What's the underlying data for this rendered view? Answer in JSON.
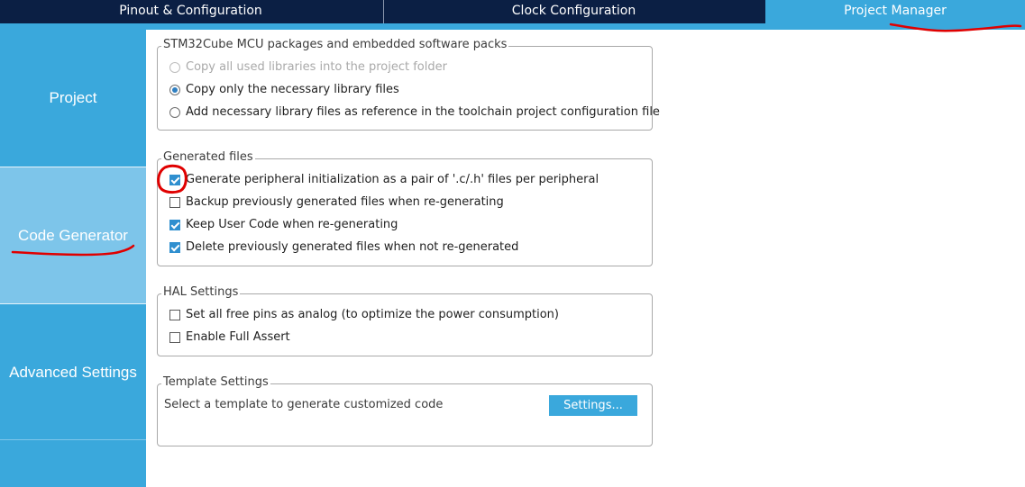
{
  "tabs": [
    {
      "label": "Pinout & Configuration"
    },
    {
      "label": "Clock Configuration"
    },
    {
      "label": "Project Manager"
    }
  ],
  "sidebar": {
    "items": [
      {
        "label": "Project"
      },
      {
        "label": "Code Generator"
      },
      {
        "label": "Advanced Settings"
      }
    ]
  },
  "packages": {
    "title": "STM32Cube MCU packages and embedded software packs",
    "options": [
      {
        "label": "Copy all used libraries into the project folder",
        "selected": false,
        "enabled": false
      },
      {
        "label": "Copy only the necessary library files",
        "selected": true,
        "enabled": true
      },
      {
        "label": "Add necessary library files as reference in the toolchain project configuration file",
        "selected": false,
        "enabled": true
      }
    ]
  },
  "generated": {
    "title": "Generated files",
    "options": [
      {
        "label": "Generate peripheral initialization as a pair of '.c/.h' files per peripheral",
        "checked": true
      },
      {
        "label": "Backup previously generated files when re-generating",
        "checked": false
      },
      {
        "label": "Keep User Code when re-generating",
        "checked": true
      },
      {
        "label": "Delete previously generated files when not re-generated",
        "checked": true
      }
    ]
  },
  "hal": {
    "title": "HAL Settings",
    "options": [
      {
        "label": "Set all free pins as analog (to optimize the power consumption)",
        "checked": false
      },
      {
        "label": "Enable Full Assert",
        "checked": false
      }
    ]
  },
  "template": {
    "title": "Template Settings",
    "text": "Select a template to generate customized code",
    "button": "Settings..."
  },
  "colors": {
    "tab_bar": "#0b1f44",
    "accent": "#3aa8dc",
    "sidebar_active": "#7dc5ea",
    "annotation": "#e00000"
  }
}
